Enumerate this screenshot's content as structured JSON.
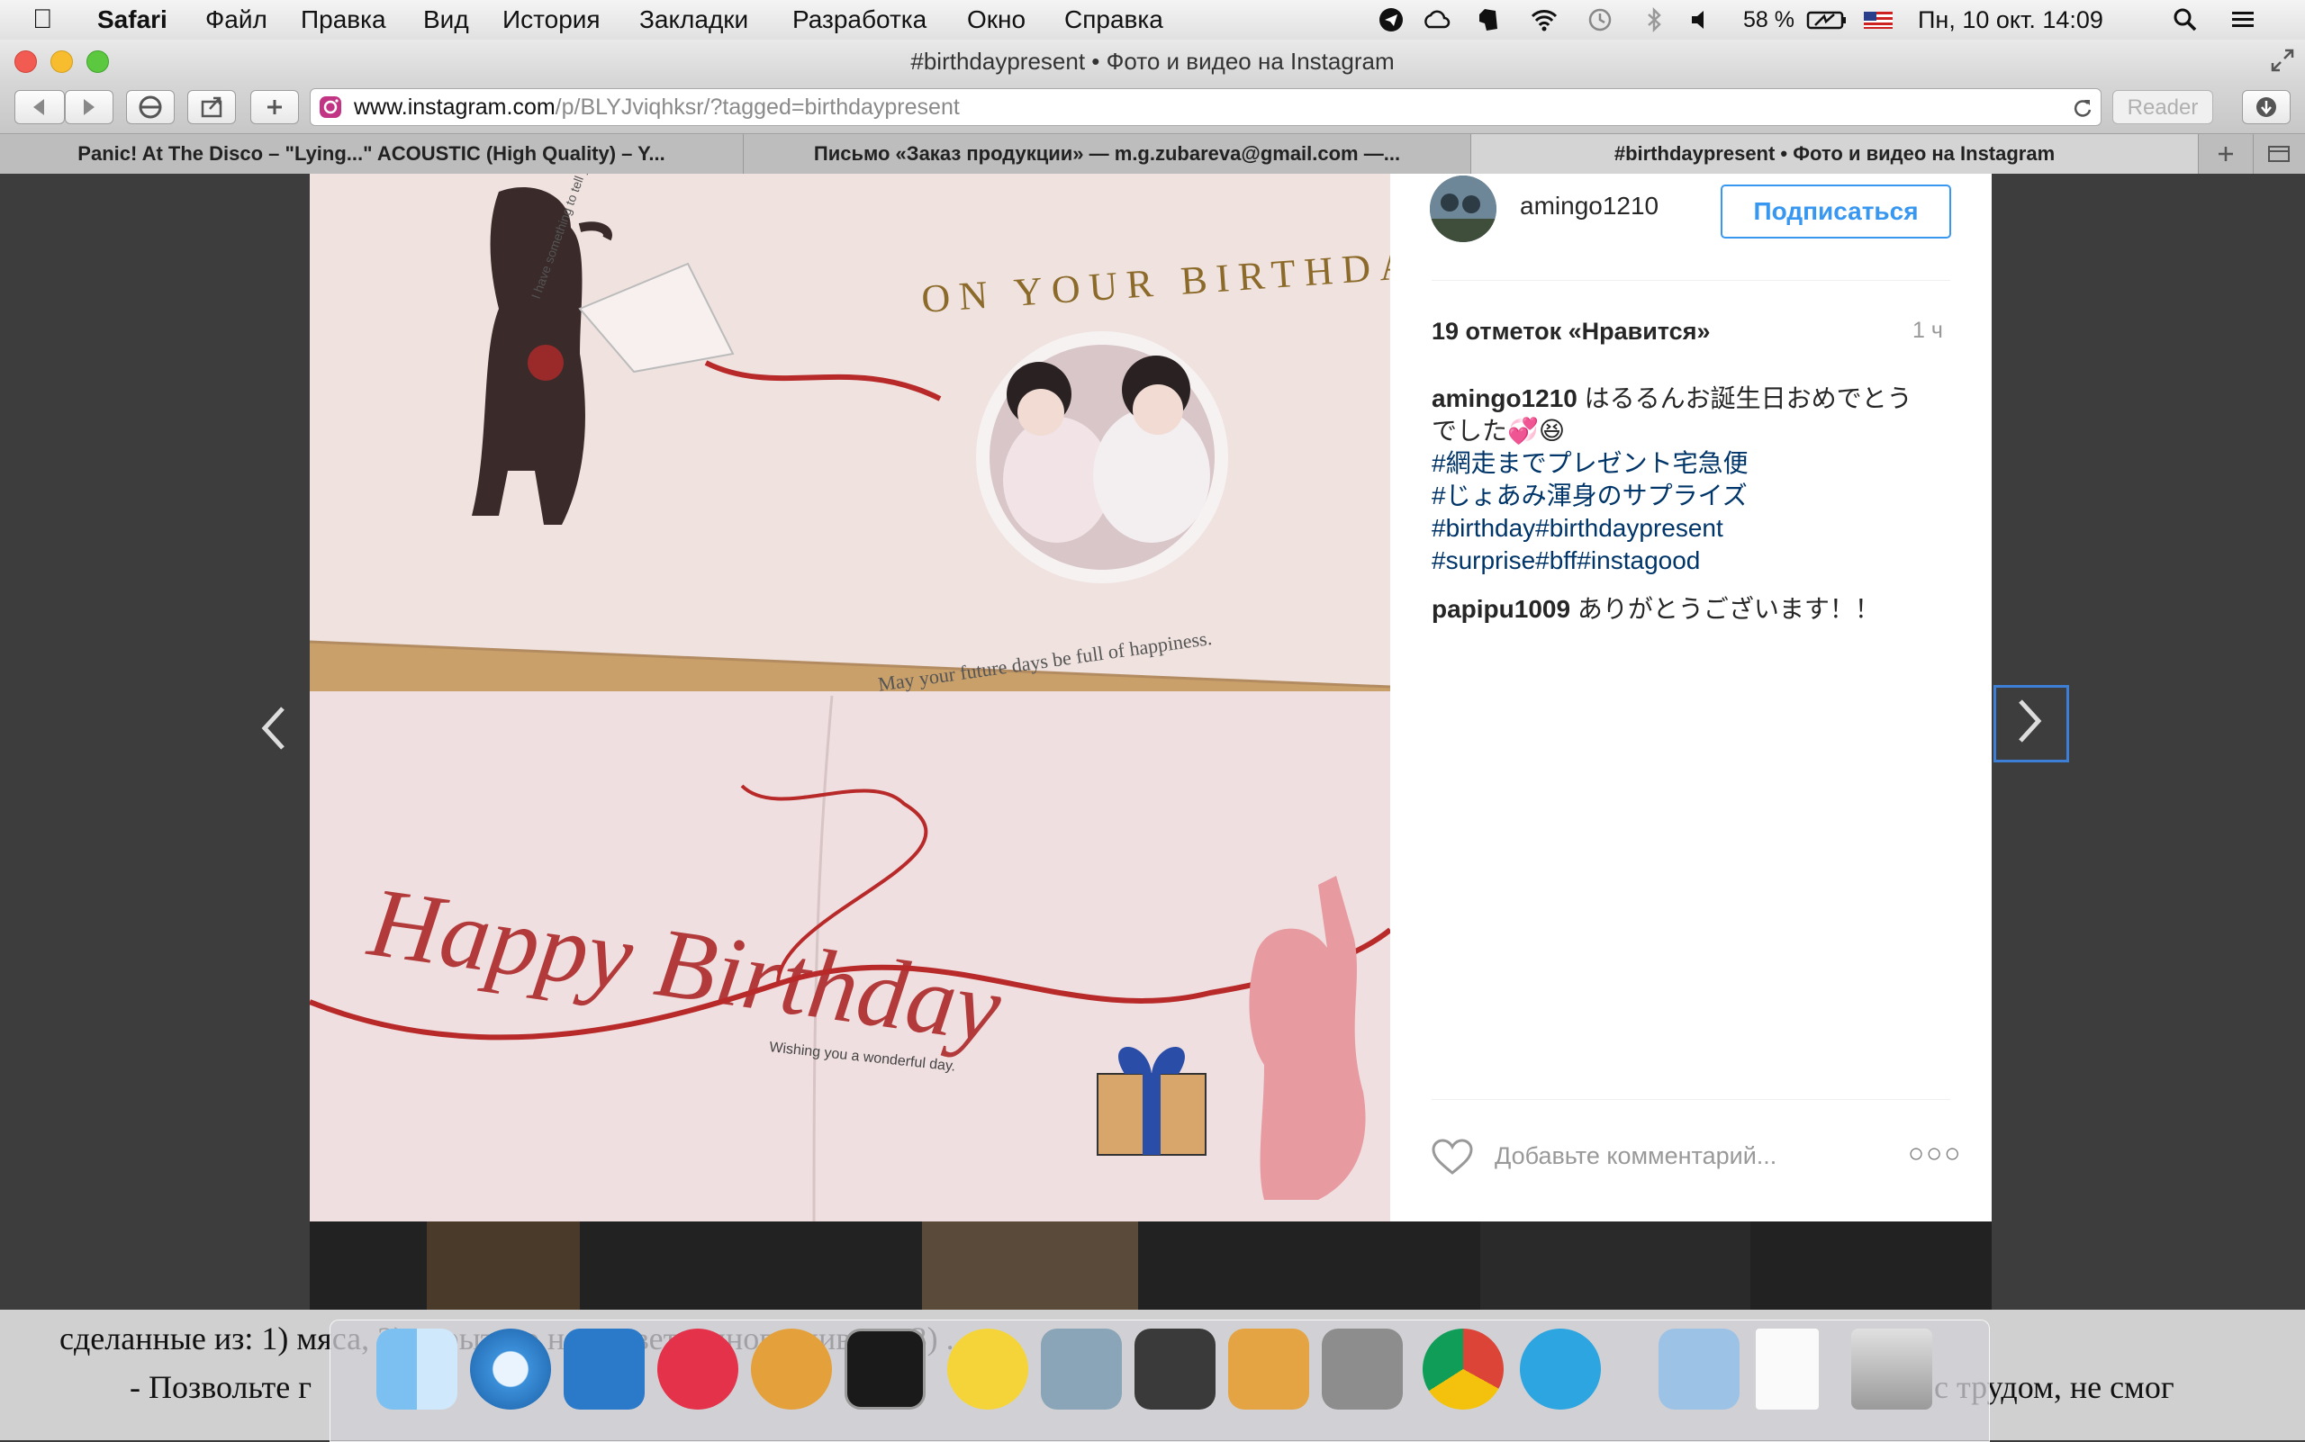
{
  "menubar": {
    "app": "Safari",
    "items": [
      "Файл",
      "Правка",
      "Вид",
      "История",
      "Закладки",
      "Разработка",
      "Окно",
      "Справка"
    ],
    "battery": "58 %",
    "datetime": "Пн, 10 окт.  14:09"
  },
  "window": {
    "title": "#birthdaypresent • Фото и видео на Instagram",
    "url_host": "www.instagram.com",
    "url_path": "/p/BLYJviqhksr/?tagged=birthdaypresent",
    "reader_label": "Reader"
  },
  "tabs": [
    {
      "label": "Panic! At The Disco – \"Lying...\" ACOUSTIC (High Quality) – Y..."
    },
    {
      "label": "Письмо «Заказ продукции» — m.g.zubareva@gmail.com —..."
    },
    {
      "label": "#birthdaypresent • Фото и видео на Instagram"
    }
  ],
  "post": {
    "username": "amingo1210",
    "follow_label": "Подписаться",
    "likes": "19 отметок «Нравится»",
    "time": "1 ч",
    "caption_user": "amingo1210",
    "caption_text": "はるるんお誕生日おめでとうでした💞😆",
    "hashtags": [
      "#網走までプレゼント宅急便",
      "#じょあみ渾身のサプライズ",
      "#birthday#birthdaypresent",
      "#surprise#bff#instagood"
    ],
    "comment_user": "papipu1009",
    "comment_text": "ありがとうございます！！",
    "add_comment_placeholder": "Добавьте комментарий...",
    "more": "○○○"
  },
  "photo": {
    "card_top_arc": "ON YOUR BIRTHDAY",
    "card_top_small": "I have something to tell you",
    "card_circle_text": "May your future days be full of happiness.",
    "card_bottom_script": "Happy Birthday",
    "card_bottom_small": "Wishing you a wonderful day."
  },
  "background_doc": {
    "line1": "сделанные из: 1) мяса, 2) изрытого наук...ветренного живот...  3) ...",
    "line2": "- Позвольте  г",
    "line3": "с  трудом,  не  смог"
  },
  "colors": {
    "accent": "#3897f0",
    "hashtag": "#003569"
  }
}
